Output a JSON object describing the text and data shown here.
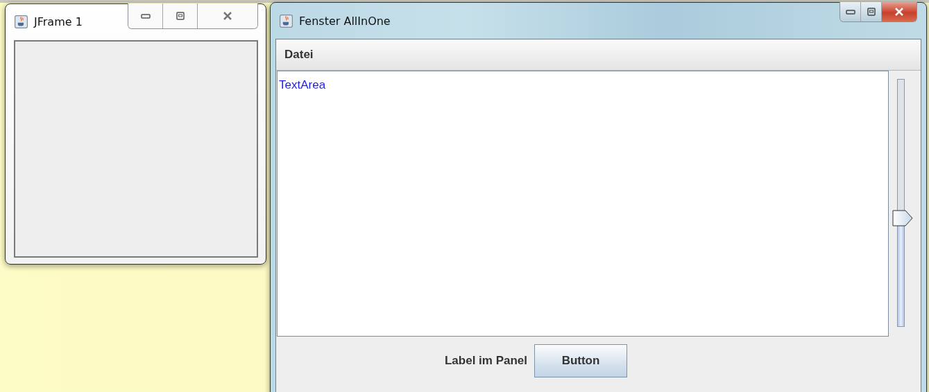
{
  "windows": [
    {
      "title": "JFrame 1",
      "active": false
    },
    {
      "title": "Fenster AllInOne",
      "active": true
    }
  ],
  "menu_bar": {
    "items": [
      "Datei"
    ]
  },
  "text_area": {
    "value": "TextArea"
  },
  "slider": {
    "level": 0.44
  },
  "panel": {
    "label": "Label im Panel",
    "button": "Button"
  }
}
